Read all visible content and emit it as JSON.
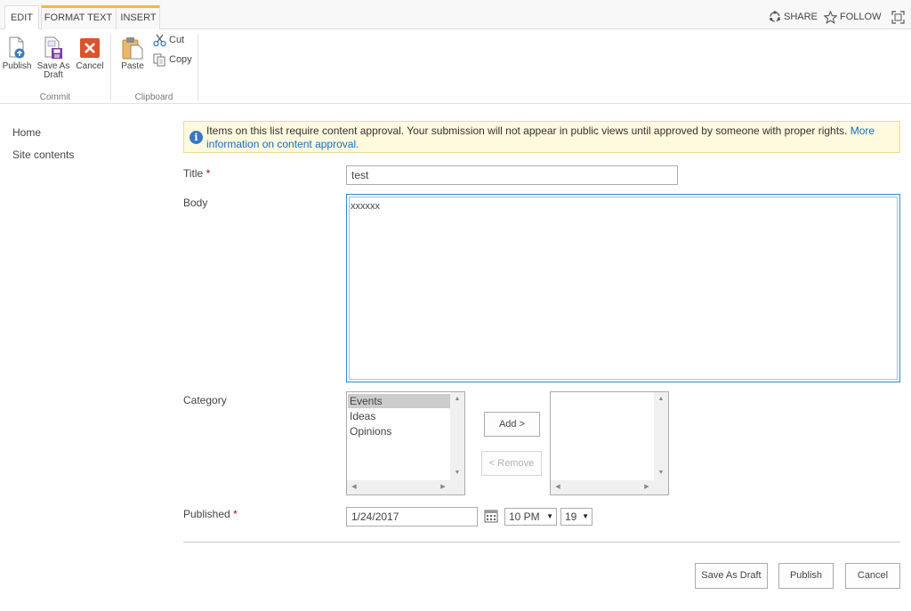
{
  "ribbon": {
    "tabs": {
      "edit": "EDIT",
      "format_text": "FORMAT TEXT",
      "insert": "INSERT"
    },
    "top_actions": {
      "share": "SHARE",
      "follow": "FOLLOW"
    },
    "commit": {
      "publish": "Publish",
      "save_as_draft_line1": "Save As",
      "save_as_draft_line2": "Draft",
      "cancel": "Cancel",
      "group_label": "Commit"
    },
    "clipboard": {
      "paste": "Paste",
      "cut": "Cut",
      "copy": "Copy",
      "group_label": "Clipboard"
    }
  },
  "nav": {
    "items": [
      {
        "label": "Home"
      },
      {
        "label": "Site contents"
      }
    ]
  },
  "banner": {
    "text": "Items on this list require content approval. Your submission will not appear in public views until approved by someone with proper rights.",
    "link": "More information on content approval."
  },
  "form": {
    "title": {
      "label": "Title",
      "required_marker": "*",
      "value": "test"
    },
    "body": {
      "label": "Body",
      "value": "xxxxxx"
    },
    "category": {
      "label": "Category",
      "available": [
        "Events",
        "Ideas",
        "Opinions"
      ],
      "selected_index": 0,
      "add_button": "Add >",
      "remove_button": "< Remove"
    },
    "published": {
      "label": "Published",
      "required_marker": "*",
      "date": "1/24/2017",
      "hour": "10 PM",
      "minute": "19"
    }
  },
  "footer": {
    "save_as_draft": "Save As Draft",
    "publish": "Publish",
    "cancel": "Cancel"
  },
  "colors": {
    "accent": "#0f6fc6",
    "context_tab": "#f2b84b",
    "banner_bg": "#fff9de",
    "cancel_icon": "#d9532c"
  }
}
